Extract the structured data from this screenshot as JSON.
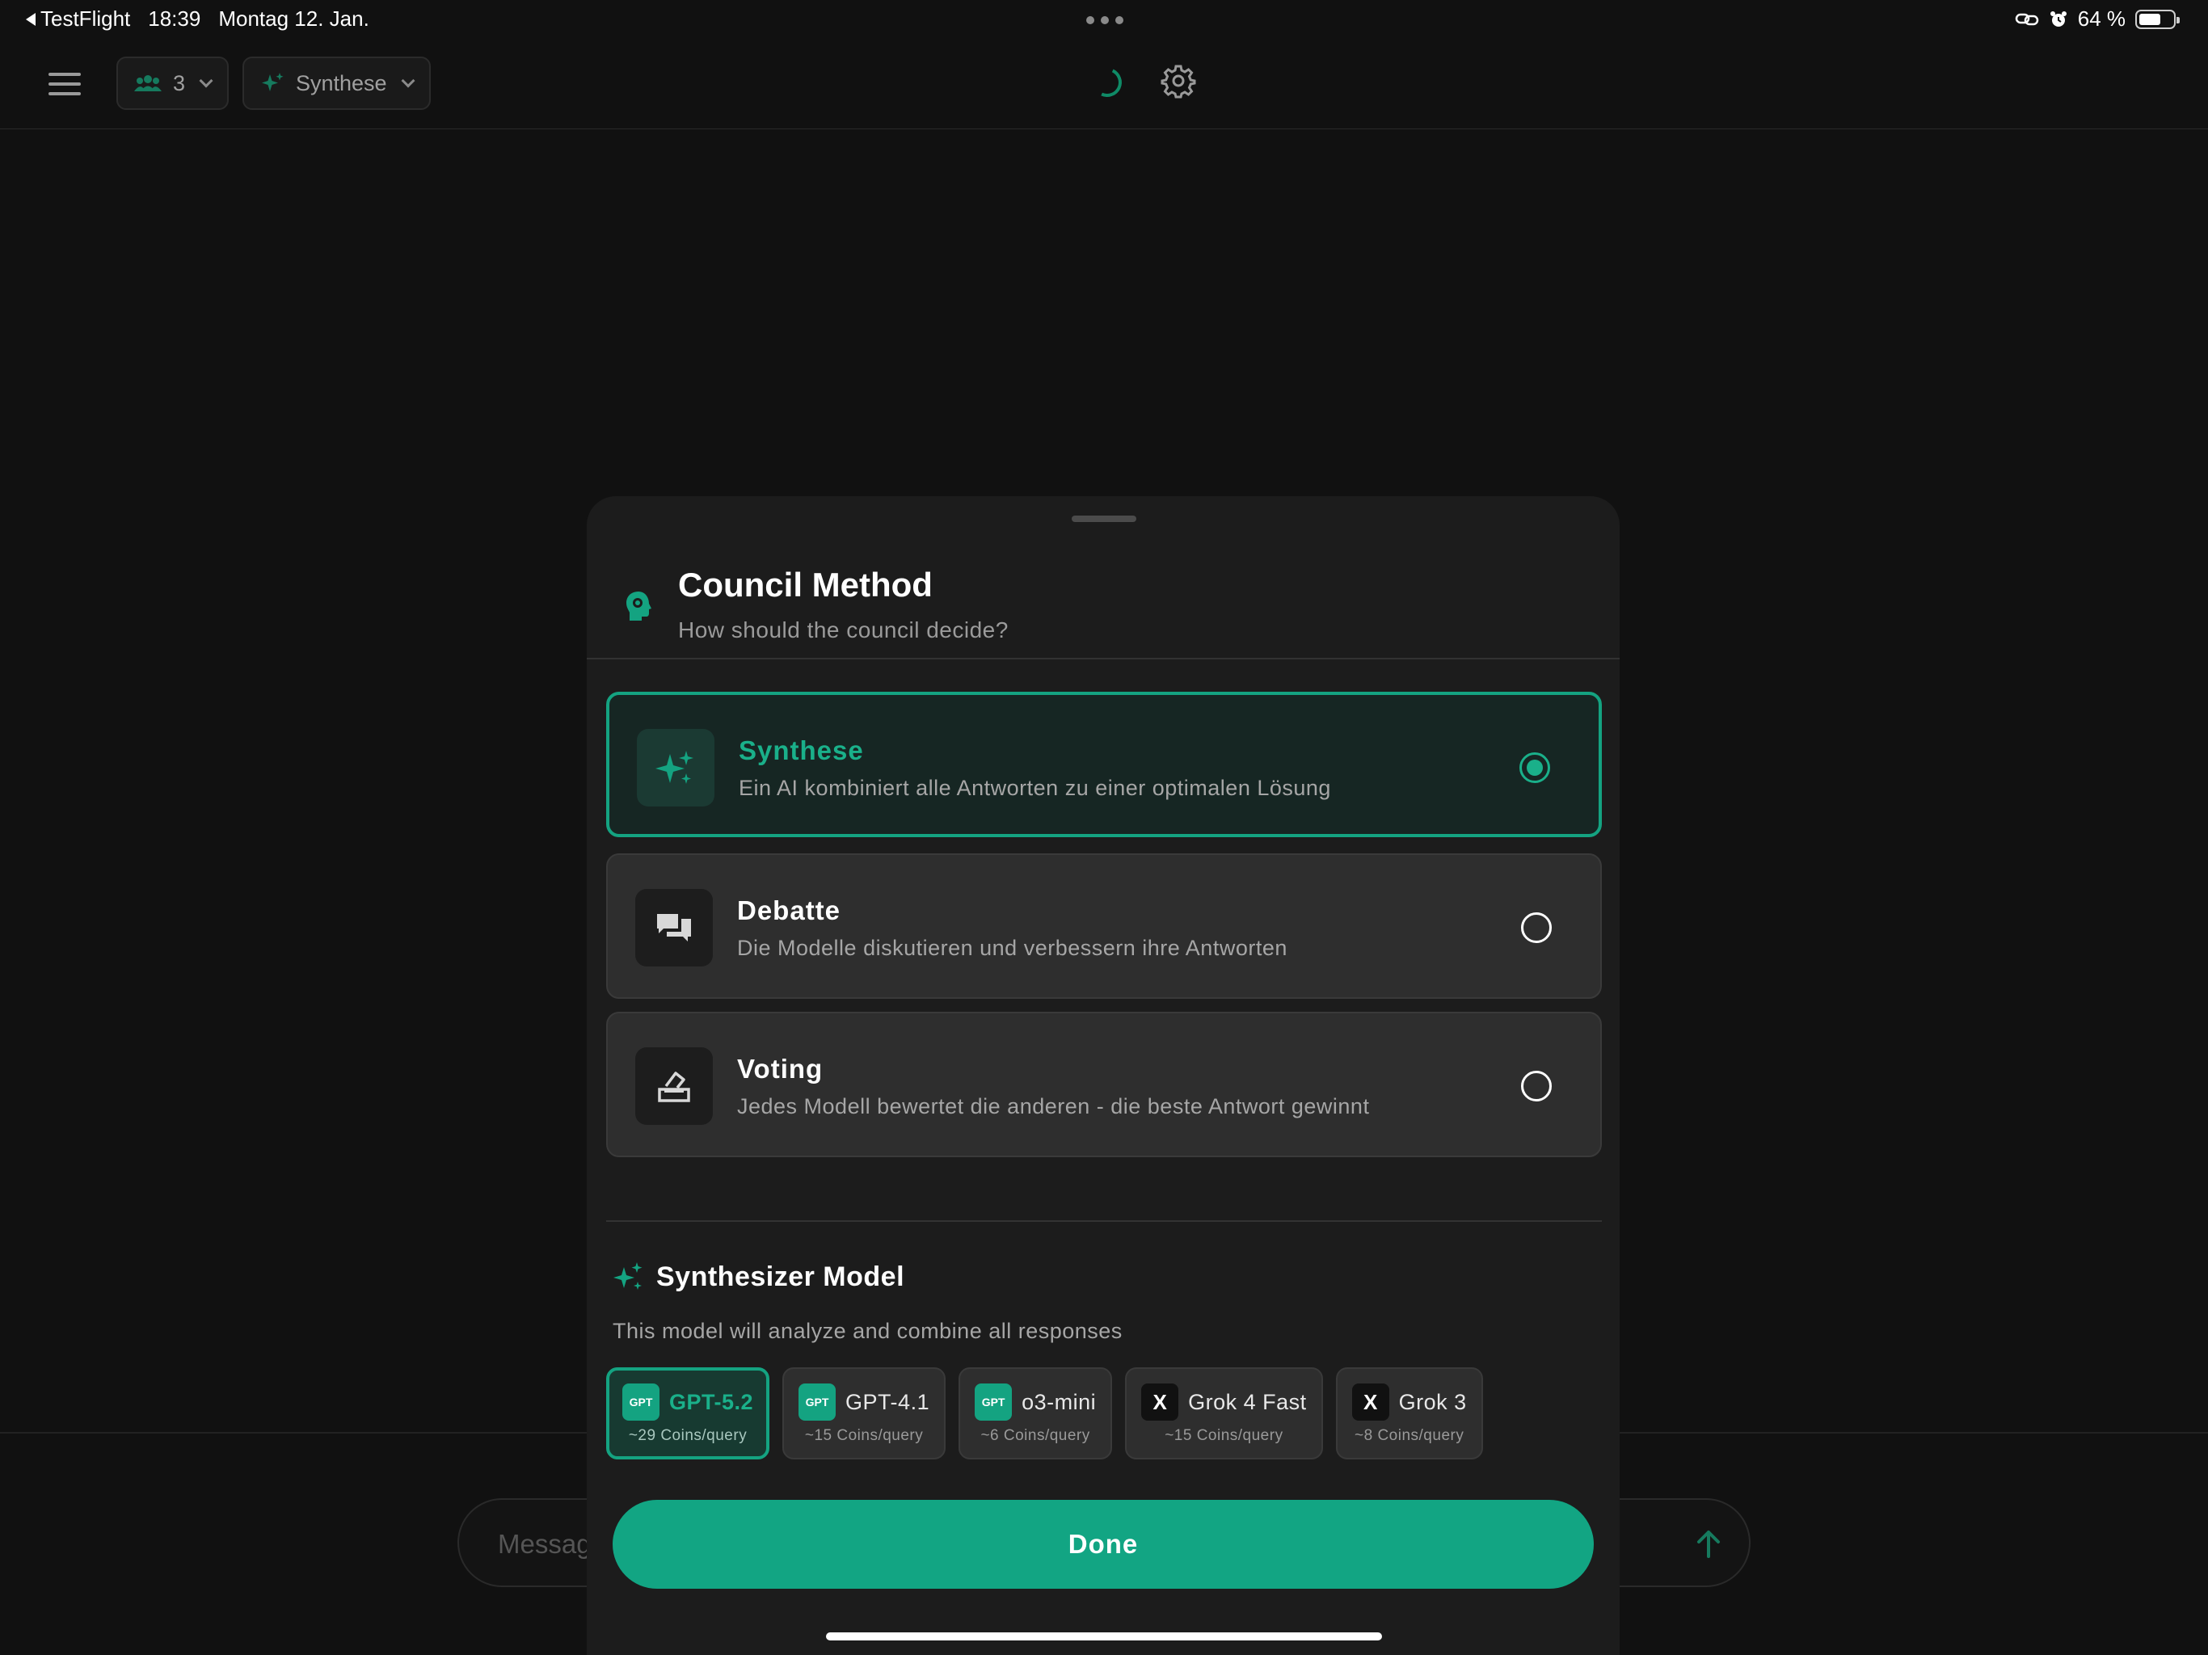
{
  "status_bar": {
    "back_app": "TestFlight",
    "time": "18:39",
    "date": "Montag 12. Jan.",
    "battery_percent": "64 %",
    "battery_level": 0.64
  },
  "toolbar": {
    "participant_count": "3",
    "method_label": "Synthese"
  },
  "background": {
    "message_placeholder": "Messag"
  },
  "sheet": {
    "title": "Council Method",
    "subtitle": "How should the council decide?",
    "methods": [
      {
        "title": "Synthese",
        "description": "Ein AI kombiniert alle Antworten zu einer optimalen Lösung",
        "selected": true,
        "icon": "sparkles-icon"
      },
      {
        "title": "Debatte",
        "description": "Die Modelle diskutieren und verbessern ihre Antworten",
        "selected": false,
        "icon": "chat-bubbles-icon"
      },
      {
        "title": "Voting",
        "description": "Jedes Modell bewertet die anderen - die beste Antwort gewinnt",
        "selected": false,
        "icon": "ballot-box-icon"
      }
    ],
    "synthesizer": {
      "title": "Synthesizer Model",
      "description": "This model will analyze and combine all responses",
      "models": [
        {
          "badge": "GPT",
          "name": "GPT-5.2",
          "cost": "~29 Coins/query",
          "selected": true
        },
        {
          "badge": "GPT",
          "name": "GPT-4.1",
          "cost": "~15 Coins/query",
          "selected": false
        },
        {
          "badge": "GPT",
          "name": "o3-mini",
          "cost": "~6 Coins/query",
          "selected": false
        },
        {
          "badge": "X",
          "name": "Grok 4 Fast",
          "cost": "~15 Coins/query",
          "selected": false
        },
        {
          "badge": "X",
          "name": "Grok 3",
          "cost": "~8 Coins/query",
          "selected": false
        }
      ]
    },
    "done_label": "Done"
  },
  "colors": {
    "accent": "#14a381",
    "background": "#111111",
    "sheet": "#1c1c1c"
  }
}
